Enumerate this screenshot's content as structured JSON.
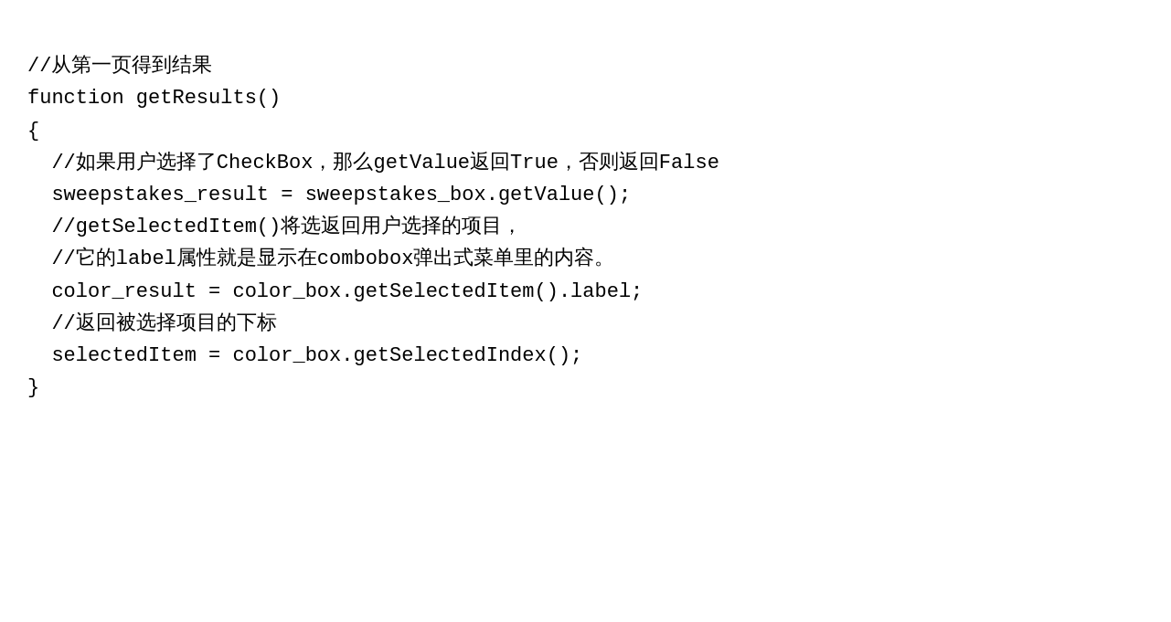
{
  "code": {
    "lines": [
      {
        "id": "comment-heading",
        "text": "//从第一页得到结果",
        "indent": 0
      },
      {
        "id": "function-decl",
        "text": "function getResults()",
        "indent": 0
      },
      {
        "id": "open-brace",
        "text": "{",
        "indent": 0
      },
      {
        "id": "comment-checkbox",
        "text": "  //如果用户选择了CheckBox，那么getValue返回True，否则返回False",
        "indent": 0
      },
      {
        "id": "sweepstakes-result",
        "text": "  sweepstakes_result = sweepstakes_box.getValue();",
        "indent": 0
      },
      {
        "id": "comment-getselecteditem1",
        "text": "  //getSelectedItem()将选返回用户选择的项目，",
        "indent": 0
      },
      {
        "id": "comment-getselecteditem2",
        "text": "  //它的label属性就是显示在combobox弹出式菜单里的内容。",
        "indent": 0
      },
      {
        "id": "color-result",
        "text": "  color_result = color_box.getSelectedItem().label;",
        "indent": 0
      },
      {
        "id": "comment-index",
        "text": "  //返回被选择项目的下标",
        "indent": 0
      },
      {
        "id": "selected-item",
        "text": "  selectedItem = color_box.getSelectedIndex();",
        "indent": 0
      },
      {
        "id": "close-brace",
        "text": "}",
        "indent": 0
      }
    ]
  }
}
